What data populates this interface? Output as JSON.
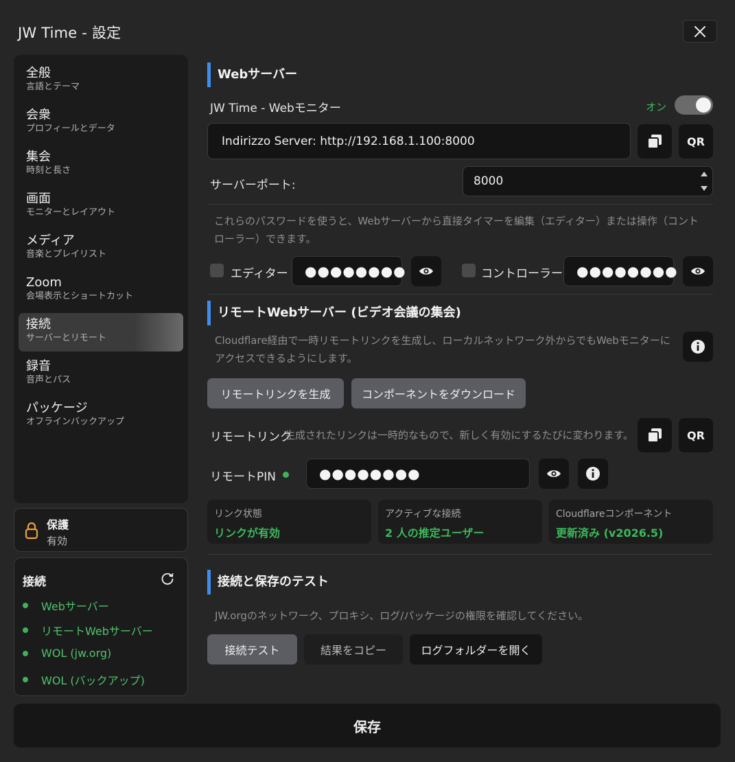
{
  "window": {
    "title": "JW Time - 設定"
  },
  "sidebar": {
    "items": [
      {
        "label": "全般",
        "sub": "言語とテーマ"
      },
      {
        "label": "会衆",
        "sub": "プロフィールとデータ"
      },
      {
        "label": "集会",
        "sub": "時刻と長さ"
      },
      {
        "label": "画面",
        "sub": "モニターとレイアウト"
      },
      {
        "label": "メディア",
        "sub": "音楽とプレイリスト"
      },
      {
        "label": "Zoom",
        "sub": "会場表示とショートカット"
      },
      {
        "label": "接続",
        "sub": "サーバーとリモート"
      },
      {
        "label": "録音",
        "sub": "音声とパス"
      },
      {
        "label": "パッケージ",
        "sub": "オフラインバックアップ"
      }
    ],
    "active_index": 6
  },
  "protection": {
    "title": "保護",
    "status": "有効"
  },
  "connections": {
    "title": "接続",
    "items": [
      "Webサーバー",
      "リモートWebサーバー",
      "WOL (jw.org)",
      "WOL (バックアップ)"
    ],
    "status_color": "#3cb35a"
  },
  "web_server": {
    "section_title": "Webサーバー",
    "monitor_label": "JW Time - Webモニター",
    "toggle_label": "オン",
    "address": "Indirizzo Server: http://192.168.1.100:8000",
    "qr_label": "QR",
    "port_label": "サーバーポート:",
    "port_value": "8000",
    "password_note": "これらのパスワードを使うと、Webサーバーから直接タイマーを編集（エディター）または操作（コントローラー）できます。",
    "editor_label": "エディター",
    "editor_password": "●●●●●●●●",
    "controller_label": "コントローラー",
    "controller_password": "●●●●●●●●"
  },
  "remote_server": {
    "section_title": "リモートWebサーバー (ビデオ会議の集会)",
    "description": "Cloudflare経由で一時リモートリンクを生成し、ローカルネットワーク外からでもWebモニターにアクセスできるようにします。",
    "generate_button": "リモートリンクを生成",
    "download_button": "コンポーネントをダウンロード",
    "link_label": "リモートリンク",
    "link_note": "生成されたリンクは一時的なもので、新しく有効にするたびに変わります。",
    "qr_label": "QR",
    "pin_label": "リモートPIN",
    "pin_value": "●●●●●●●●",
    "stats": [
      {
        "label": "リンク状態",
        "value": "リンクが有効"
      },
      {
        "label": "アクティブな接続",
        "value": "2 人の推定ユーザー"
      },
      {
        "label": "Cloudflareコンポーネント",
        "value": "更新済み (v2026.5)"
      }
    ]
  },
  "test": {
    "section_title": "接続と保存のテスト",
    "description": "JW.orgのネットワーク、プロキシ、ログ/パッケージの権限を確認してください。",
    "test_button": "接続テスト",
    "copy_button": "結果をコピー",
    "open_logs_button": "ログフォルダーを開く"
  },
  "footer": {
    "save_label": "保存"
  },
  "colors": {
    "accent": "#3e8ef0",
    "success": "#3cb85b",
    "background": "#262626"
  }
}
